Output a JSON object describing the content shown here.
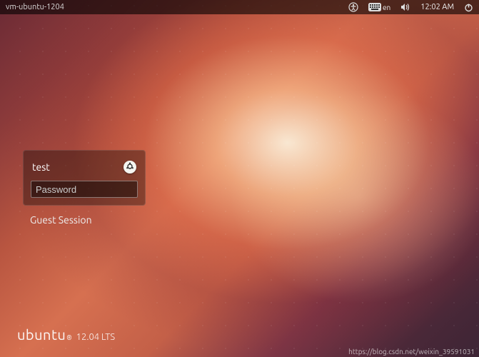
{
  "panel": {
    "hostname": "vm-ubuntu-1204",
    "keyboard_lang": "en",
    "clock": "12:02 AM"
  },
  "login": {
    "username": "test",
    "password_placeholder": "Password",
    "password_value": "",
    "guest_label": "Guest Session"
  },
  "branding": {
    "word": "ubuntu",
    "registered": "®",
    "version": "12.04 LTS"
  },
  "watermark": "https://blog.csdn.net/weixin_39591031"
}
